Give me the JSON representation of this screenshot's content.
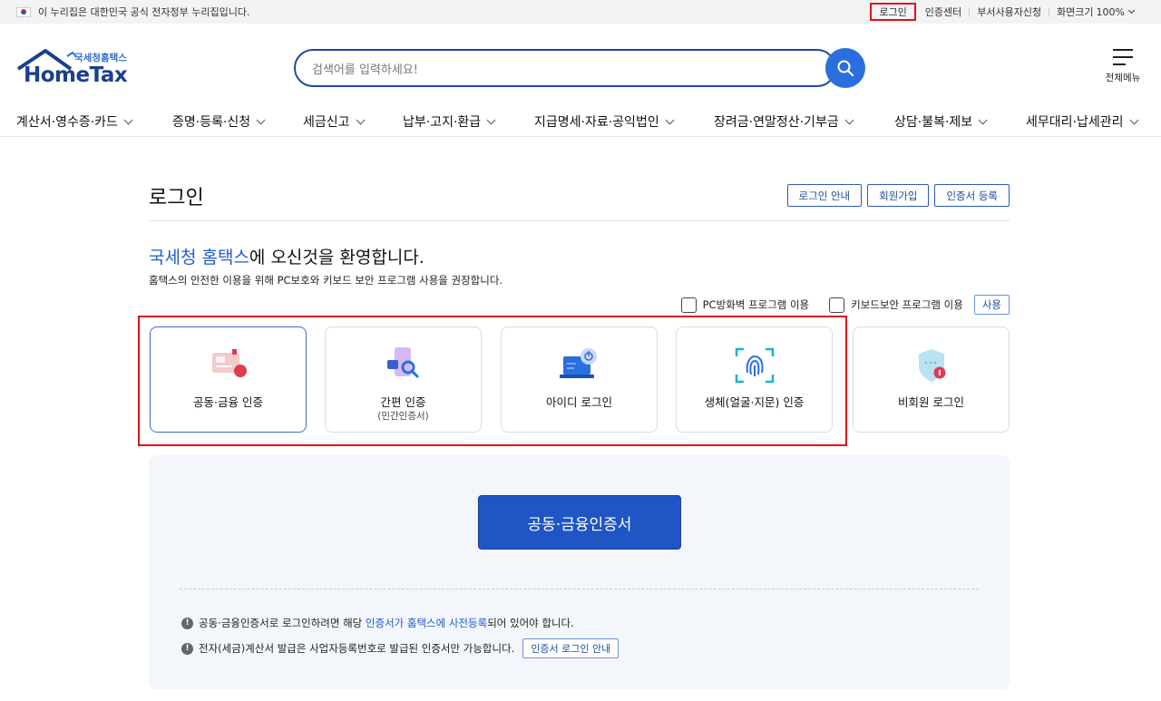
{
  "topbar": {
    "notice": "이 누리집은 대한민국 공식 전자정부 누리집입니다.",
    "login": "로그인",
    "cert_center": "인증센터",
    "dept_user": "부서사용자신청",
    "zoom_label": "화면크기",
    "zoom_value": "100%"
  },
  "header": {
    "logo_sub": "국세청홈택스",
    "logo_main": "HomeTax",
    "search_placeholder": "검색어를 입력하세요!",
    "all_menu": "전체메뉴"
  },
  "gnb": [
    "계산서·영수증·카드",
    "증명·등록·신청",
    "세금신고",
    "납부·고지·환급",
    "지급명세·자료·공익법인",
    "장려금·연말정산·기부금",
    "상담·불복·제보",
    "세무대리·납세관리"
  ],
  "page": {
    "title": "로그인",
    "buttons": [
      "로그인 안내",
      "회원가입",
      "인증서 등록"
    ],
    "welcome_highlight": "국세청 홈택스",
    "welcome_rest": "에 오신것을 환영합니다.",
    "desc": "홈택스의 안전한 이용을 위해 PC보호와 키보드 보안 프로그램 사용을 권장합니다.",
    "opt_firewall": "PC방화벽 프로그램 이용",
    "opt_keyboard": "키보드보안 프로그램 이용",
    "use_button": "사용"
  },
  "methods": [
    {
      "label": "공동·금융 인증",
      "sub": "",
      "icon": "certificate-card-icon"
    },
    {
      "label": "간편 인증",
      "sub": "(민간인증서)",
      "icon": "simple-auth-icon"
    },
    {
      "label": "아이디 로그인",
      "sub": "",
      "icon": "laptop-power-icon"
    },
    {
      "label": "생체(얼굴·지문) 인증",
      "sub": "",
      "icon": "fingerprint-icon"
    },
    {
      "label": "비회원 로그인",
      "sub": "",
      "icon": "shield-lock-icon"
    }
  ],
  "panel": {
    "big_button": "공동·금융인증서",
    "note1_pre": "공동·금융인증서로 로그인하려면 해당 ",
    "note1_link": "인증서가 홈택스에 사전등록",
    "note1_post": "되어 있어야 합니다.",
    "note2": "전자(세금)계산서 발급은 사업자등록번호로 발급된 인증서만 가능합니다.",
    "note2_button": "인증서 로그인 안내"
  },
  "colors": {
    "brand_blue": "#1f55c4",
    "highlight_red": "#e0101a",
    "panel_bg": "#f3f6fb"
  }
}
